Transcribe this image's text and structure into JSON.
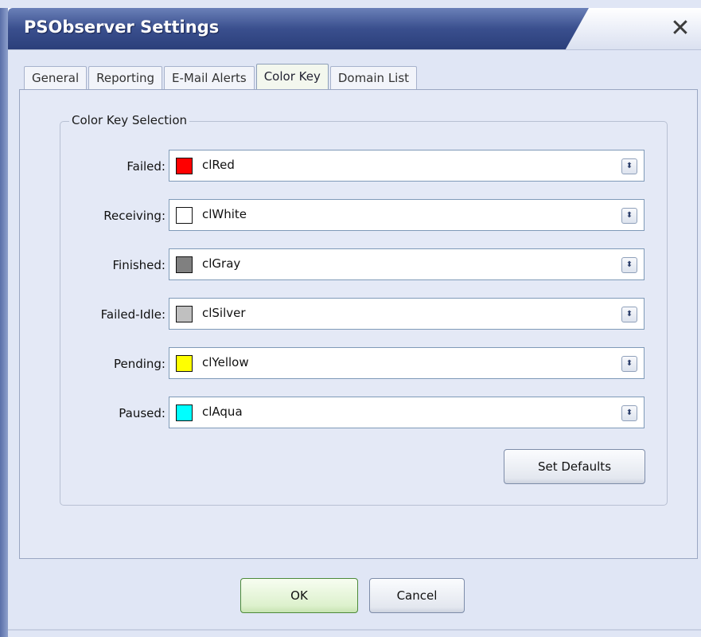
{
  "window": {
    "title": "PSObserver Settings",
    "close_glyph": "✕"
  },
  "tabs": [
    {
      "label": "General",
      "active": false
    },
    {
      "label": "Reporting",
      "active": false
    },
    {
      "label": "E-Mail Alerts",
      "active": false
    },
    {
      "label": "Color Key",
      "active": true
    },
    {
      "label": "Domain List",
      "active": false
    }
  ],
  "group": {
    "title": "Color Key Selection"
  },
  "rows": [
    {
      "label": "Failed:",
      "value": "clRed",
      "swatch": "#ff0000"
    },
    {
      "label": "Receiving:",
      "value": "clWhite",
      "swatch": "#ffffff"
    },
    {
      "label": "Finished:",
      "value": "clGray",
      "swatch": "#808080"
    },
    {
      "label": "Failed-Idle:",
      "value": "clSilver",
      "swatch": "#c0c0c0"
    },
    {
      "label": "Pending:",
      "value": "clYellow",
      "swatch": "#ffff00"
    },
    {
      "label": "Paused:",
      "value": "clAqua",
      "swatch": "#00ffff"
    }
  ],
  "buttons": {
    "set_defaults": "Set Defaults",
    "ok": "OK",
    "cancel": "Cancel"
  },
  "icons": {
    "combo_arrow": "up-down-arrow-icon",
    "close": "close-icon"
  }
}
